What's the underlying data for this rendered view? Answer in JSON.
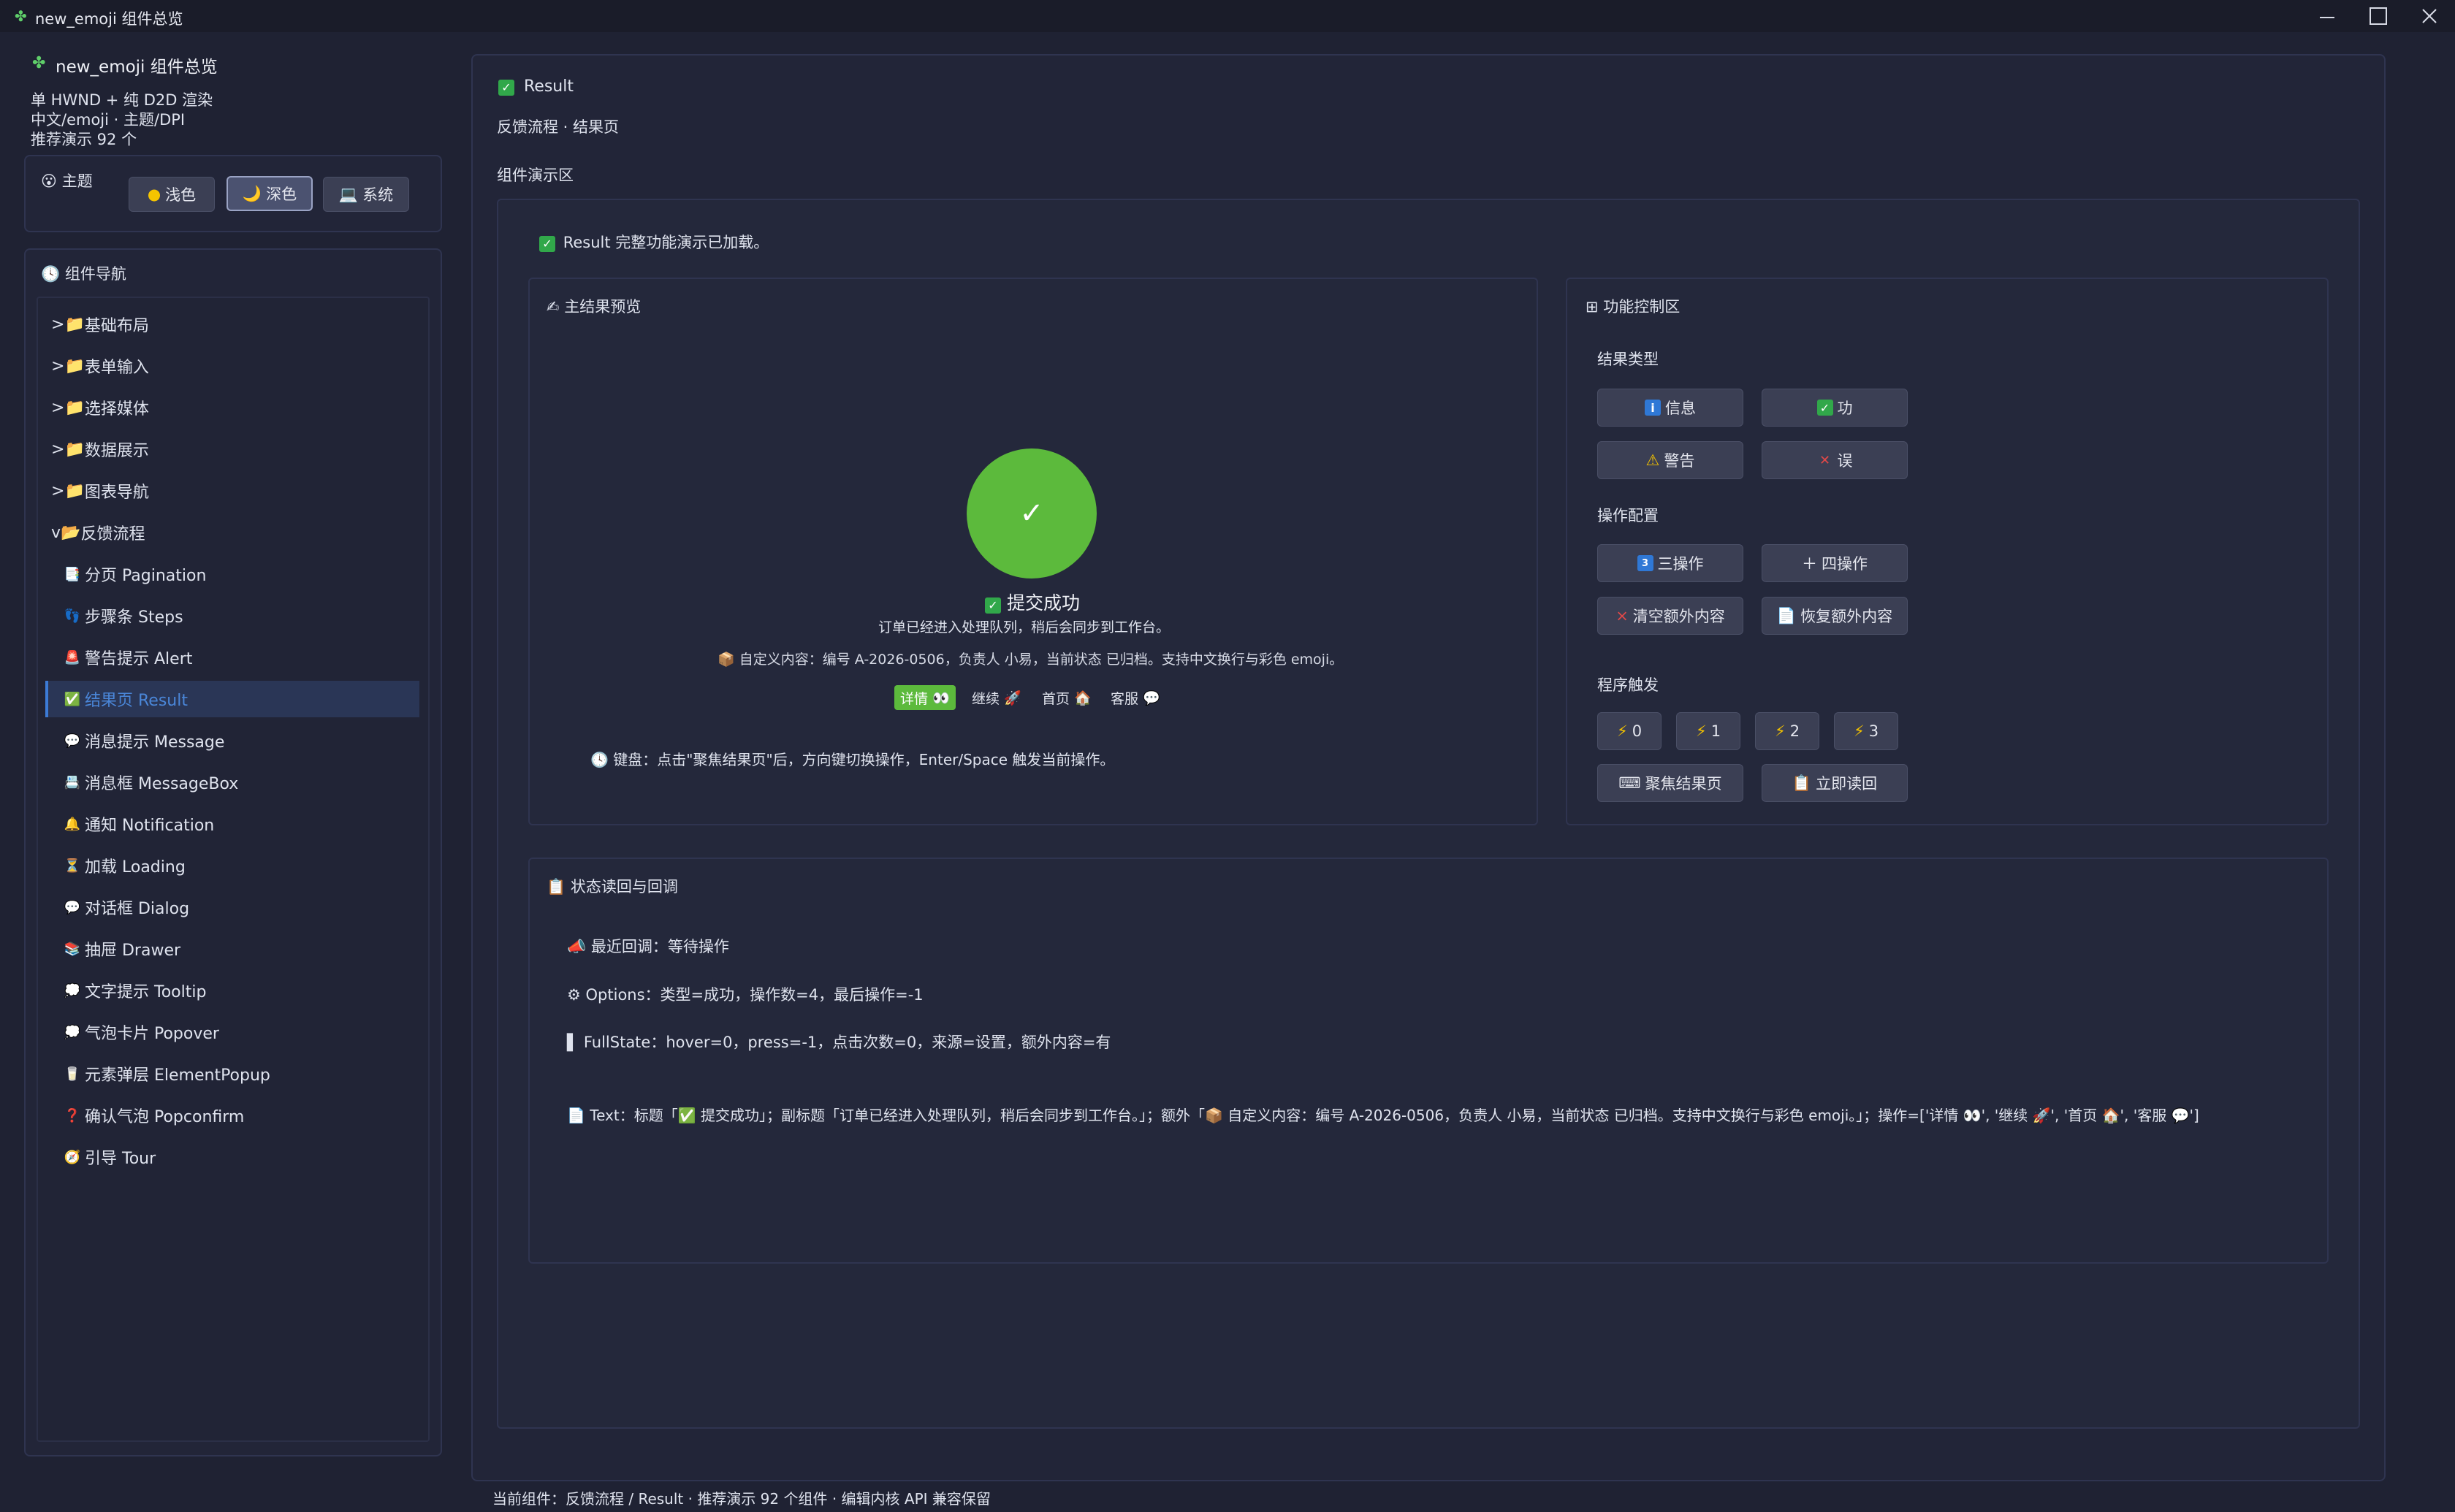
{
  "window": {
    "title": "new_emoji 组件总览"
  },
  "sidebar": {
    "app_title": "new_emoji 组件总览",
    "desc_lines": [
      "单 HWND + 纯 D2D 渲染",
      "中文/emoji · 主题/DPI",
      "推荐演示 92 个"
    ],
    "theme": {
      "label": "主题",
      "options": [
        {
          "icon": "●",
          "label": "浅色"
        },
        {
          "icon": "🌙",
          "label": "深色"
        },
        {
          "icon": "💻",
          "label": "系统"
        }
      ],
      "selected": "深色"
    },
    "nav_title": "组件导航",
    "groups": [
      {
        "prefix": ">",
        "label": "基础布局"
      },
      {
        "prefix": ">",
        "label": "表单输入"
      },
      {
        "prefix": ">",
        "label": "选择媒体"
      },
      {
        "prefix": ">",
        "label": "数据展示"
      },
      {
        "prefix": ">",
        "label": "图表导航"
      },
      {
        "prefix": "v",
        "label": "反馈流程"
      }
    ],
    "items": [
      {
        "icon": "📑",
        "label": "分页 Pagination"
      },
      {
        "icon": "👣",
        "label": "步骤条 Steps"
      },
      {
        "icon": "🚨",
        "label": "警告提示 Alert"
      },
      {
        "icon": "✅",
        "label": "结果页 Result"
      },
      {
        "icon": "💬",
        "label": "消息提示 Message"
      },
      {
        "icon": "📇",
        "label": "消息框 MessageBox"
      },
      {
        "icon": "🔔",
        "label": "通知 Notification"
      },
      {
        "icon": "⏳",
        "label": "加载 Loading"
      },
      {
        "icon": "💬",
        "label": "对话框 Dialog"
      },
      {
        "icon": "📚",
        "label": "抽屉 Drawer"
      },
      {
        "icon": "💭",
        "label": "文字提示 Tooltip"
      },
      {
        "icon": "💭",
        "label": "气泡卡片 Popover"
      },
      {
        "icon": "🥛",
        "label": "元素弹层 ElementPopup"
      },
      {
        "icon": "❓",
        "label": "确认气泡 Popconfirm"
      },
      {
        "icon": "🧭",
        "label": "引导 Tour"
      }
    ],
    "selected_item": "结果页 Result"
  },
  "main": {
    "title": "Result",
    "subtitle": "反馈流程 · 结果页",
    "demo_label": "组件演示区",
    "loaded_msg": "Result 完整功能演示已加载。",
    "preview": {
      "title": "主结果预览",
      "status_title": "提交成功",
      "subtitle": "订单已经进入处理队列，稍后会同步到工作台。",
      "extra": "📦 自定义内容：编号 A-2026-0506，负责人 小易，当前状态 已归档。支持中文换行与彩色 emoji。",
      "actions": [
        {
          "label": "详情",
          "icon": "👀"
        },
        {
          "label": "继续",
          "icon": "🚀"
        },
        {
          "label": "首页",
          "icon": "🏠"
        },
        {
          "label": "客服",
          "icon": "💬"
        }
      ],
      "keyboard_hint": "键盘：点击\"聚焦结果页\"后，方向键切换操作，Enter/Space 触发当前操作。"
    },
    "controls": {
      "title": "功能控制区",
      "type_label": "结果类型",
      "types": [
        "信息",
        "功",
        "警告",
        "误"
      ],
      "ops_label": "操作配置",
      "ops": [
        "三操作",
        "四操作",
        "清空额外内容",
        "恢复额外内容"
      ],
      "trigger_label": "程序触发",
      "triggers": [
        "0",
        "1",
        "2",
        "3"
      ],
      "focus_btn": "聚焦结果页",
      "read_btn": "立即读回"
    },
    "status": {
      "title": "状态读回与回调",
      "last_callback": "最近回调：等待操作",
      "options": "Options：类型=成功，操作数=4，最后操作=-1",
      "fullstate": "FullState：hover=0，press=-1，点击次数=0，来源=设置，额外内容=有",
      "text": "Text：标题「✅ 提交成功」；副标题「订单已经进入处理队列，稍后会同步到工作台。」；额外「📦 自定义内容：编号 A-2026-0506，负责人 小易，当前状态 已归档。支持中文换行与彩色 emoji。」；操作=['详情 👀', '继续 🚀', '首页 🏠', '客服 💬']"
    },
    "footer": "当前组件：反馈流程 / Result · 推荐演示 92 个组件 · 编辑内核 API 兼容保留"
  },
  "colors": {
    "success": "#5cba3c",
    "selected_nav": "#2a3656",
    "accent_text": "#4a86d8"
  }
}
